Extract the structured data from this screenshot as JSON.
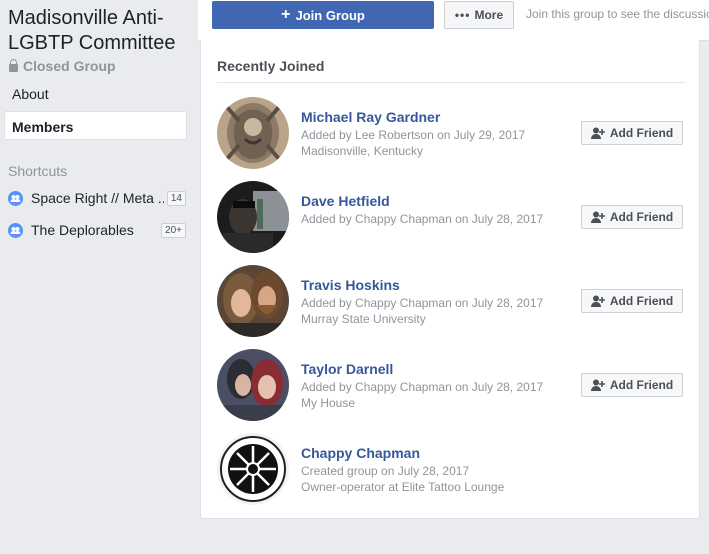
{
  "group": {
    "name": "Madisonville Anti-LGBTP Committee",
    "privacy": "Closed Group"
  },
  "nav": {
    "about": "About",
    "members": "Members"
  },
  "shortcuts": {
    "heading": "Shortcuts",
    "items": [
      {
        "label": "Space Right // Meta ...",
        "badge": "14"
      },
      {
        "label": "The Deplorables",
        "badge": "20+"
      }
    ]
  },
  "topbar": {
    "join_label": "Join Group",
    "more_label": "More",
    "join_message": "Join this group to see the discussion"
  },
  "members_section": {
    "title": "Recently Joined",
    "add_friend_label": "Add Friend",
    "members": [
      {
        "name": "Michael Ray Gardner",
        "added": "Added by Lee Robertson on July 29, 2017",
        "detail": "Madisonville, Kentucky",
        "has_add_friend": true
      },
      {
        "name": "Dave Hetfield",
        "added": "Added by Chappy Chapman on July 28, 2017",
        "detail": "",
        "has_add_friend": true
      },
      {
        "name": "Travis Hoskins",
        "added": "Added by Chappy Chapman on July 28, 2017",
        "detail": "Murray State University",
        "has_add_friend": true
      },
      {
        "name": "Taylor Darnell",
        "added": "Added by Chappy Chapman on July 28, 2017",
        "detail": "My House",
        "has_add_friend": true
      },
      {
        "name": "Chappy Chapman",
        "added": "Created group on July 28, 2017",
        "detail": "Owner-operator at Elite Tattoo Lounge",
        "has_add_friend": false
      }
    ]
  },
  "colors": {
    "brand_blue": "#4267b2",
    "link_blue": "#365899",
    "page_bg": "#e9ebee"
  }
}
